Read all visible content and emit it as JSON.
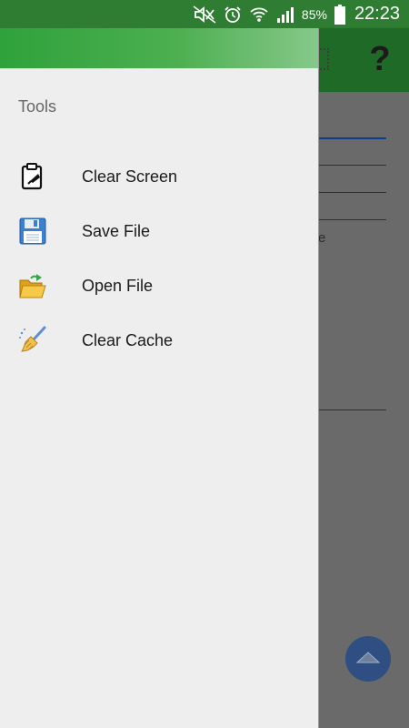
{
  "status_bar": {
    "battery_percent": "85%",
    "time": "22:23",
    "icons": [
      "mute-icon",
      "alarm-icon",
      "wifi-icon",
      "signal-icon",
      "battery-icon"
    ]
  },
  "background_app": {
    "toolbar_icons": [
      "grid-icon",
      "help-icon"
    ],
    "help_glyph": "?",
    "fragment_text": "e",
    "fab_icon": "chevron-up-icon"
  },
  "drawer": {
    "section_title": "Tools",
    "items": [
      {
        "label": "Clear Screen",
        "icon": "clipboard-icon"
      },
      {
        "label": "Save File",
        "icon": "floppy-disk-icon"
      },
      {
        "label": "Open File",
        "icon": "open-folder-icon"
      },
      {
        "label": "Clear Cache",
        "icon": "broom-icon"
      }
    ]
  },
  "colors": {
    "status_bar": "#2e7d32",
    "toolbar": "#1f6a26",
    "drawer_bg": "#eeeeee",
    "fab": "#2f4f82"
  }
}
